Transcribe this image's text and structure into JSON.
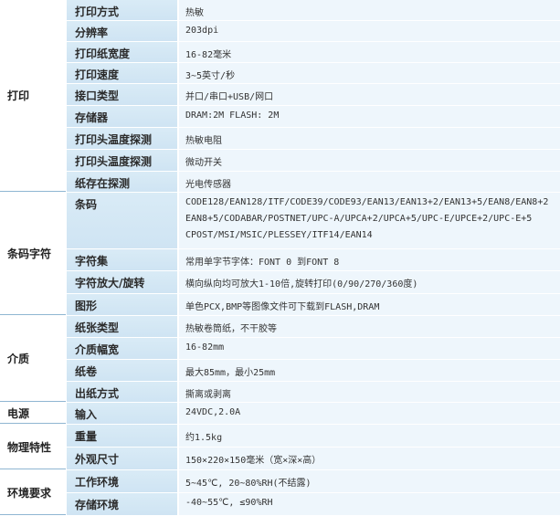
{
  "groups": [
    {
      "category": "打印",
      "rows": [
        {
          "label": "打印方式",
          "value": "热敏"
        },
        {
          "label": "分辨率",
          "value": "203dpi"
        },
        {
          "label": "打印纸宽度",
          "value": "16-82毫米"
        },
        {
          "label": "打印速度",
          "value": "3~5英寸/秒"
        },
        {
          "label": "接口类型",
          "value": "并口/串口+USB/网口"
        },
        {
          "label": "存储器",
          "value": "DRAM:2M  FLASH: 2M"
        },
        {
          "label": "打印头温度探测",
          "value": "热敏电阻"
        },
        {
          "label": "打印头温度探测",
          "value": "微动开关"
        },
        {
          "label": "纸存在探测",
          "value": "光电传感器"
        }
      ]
    },
    {
      "category": "条码字符",
      "rows": [
        {
          "label": "条码",
          "lines": [
            "CODE128/EAN128/ITF/CODE39/CODE93/EAN13/EAN13+2/EAN13+5/EAN8/EAN8+2",
            "EAN8+5/CODABAR/POSTNET/UPC-A/UPCA+2/UPCA+5/UPC-E/UPCE+2/UPC-E+5",
            "CPOST/MSI/MSIC/PLESSEY/ITF14/EAN14"
          ]
        },
        {
          "label": "字符集",
          "value": "常用单字节字体：FONT 0 到FONT 8"
        },
        {
          "label": "字符放大/旋转",
          "value": "横向纵向均可放大1-10倍,旋转打印(0/90/270/360度)"
        },
        {
          "label": "图形",
          "value": "单色PCX,BMP等图像文件可下载到FLASH,DRAM"
        }
      ]
    },
    {
      "category": "介质",
      "rows": [
        {
          "label": "纸张类型",
          "value": "热敏卷筒纸，不干胶等"
        },
        {
          "label": "介质幅宽",
          "value": "16-82mm"
        },
        {
          "label": "纸卷",
          "value": "最大85mm，最小25mm"
        },
        {
          "label": "出纸方式",
          "value": "撕离或剥离"
        }
      ]
    },
    {
      "category": "电源",
      "rows": [
        {
          "label": "输入",
          "value": "24VDC,2.0A"
        }
      ]
    },
    {
      "category": "物理特性",
      "rows": [
        {
          "label": "重量",
          "value": "约1.5kg"
        },
        {
          "label": "外观尺寸",
          "value": "150×220×150毫米（宽×深×高）"
        }
      ]
    },
    {
      "category": "环境要求",
      "rows": [
        {
          "label": "工作环境",
          "value": "5~45℃, 20~80%RH(不结露)"
        },
        {
          "label": "存储环境",
          "value": "-40~55℃, ≤90%RH"
        }
      ]
    }
  ]
}
